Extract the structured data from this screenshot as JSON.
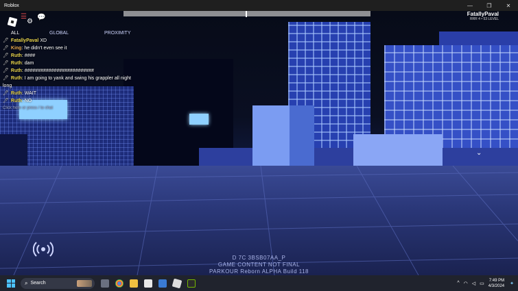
{
  "window": {
    "title": "Roblox",
    "minimize_icon": "minimize-icon",
    "maximize_icon": "maximize-icon",
    "close_icon": "close-icon"
  },
  "hud": {
    "player_name": "FatallyPaval",
    "player_level": "RRR 4 • 53 LEVEL",
    "chat_tabs": [
      "ALL",
      "GLOBAL",
      "PROXIMITY"
    ],
    "chat_messages": [
      {
        "name": "FatallyPaval",
        "text": "XD"
      },
      {
        "name": "King",
        "text": "he didn't even see it"
      },
      {
        "name": "Ruth",
        "text": "####"
      },
      {
        "name": "Ruth",
        "text": "dam"
      },
      {
        "name": "Ruth",
        "text": "##########################"
      },
      {
        "name": "Ruth",
        "text": "I am going to yank and swing his grappler all night"
      },
      {
        "name": "",
        "text": "long"
      },
      {
        "name": "Ruth",
        "text": "WAIT"
      },
      {
        "name": "Ruth",
        "text": "NO"
      }
    ],
    "chat_hint": "Click here or press / to chat"
  },
  "build": {
    "code": "D 7C 3BSB07AA_P",
    "notice": "GAME CONTENT NOT FINAL",
    "version": "PARKOUR Reborn  ALPHA  Build 118"
  },
  "taskbar": {
    "search_placeholder": "Search",
    "time": "7:49 PM",
    "date": "4/3/2024"
  },
  "colors": {
    "accent": "#4cc2ff",
    "sky": "#070b18",
    "building_blue": "#2740b0"
  }
}
